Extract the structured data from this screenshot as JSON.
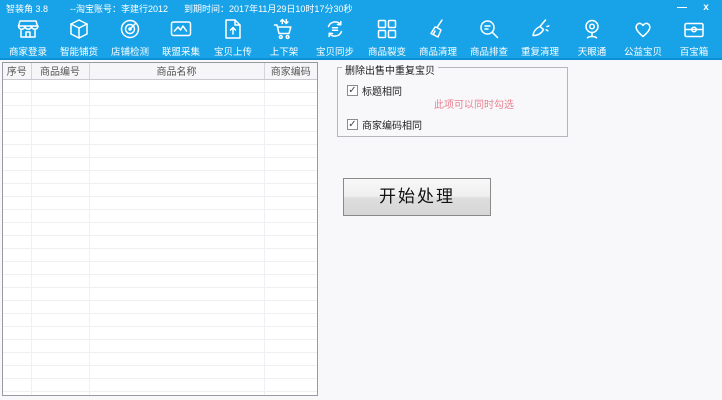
{
  "window": {
    "app_title": "智装角 3.8",
    "account": "--淘宝账号：李建行2012",
    "expire": "到期时间：2017年11月29日10时17分30秒",
    "minimize_glyph": "—",
    "close_glyph": "x"
  },
  "colors": {
    "titlebar_blue": "#18a3e8",
    "toolbar_divider": "#0d90d4",
    "hint_red": "#e8808f"
  },
  "toolbar": {
    "items": [
      {
        "label": "商家登录",
        "icon": "storefront-icon"
      },
      {
        "label": "智能铺货",
        "icon": "package-icon"
      },
      {
        "label": "店铺检测",
        "icon": "radar-icon"
      },
      {
        "label": "联盟采集",
        "icon": "capture-frame-icon"
      },
      {
        "label": "宝贝上传",
        "icon": "upload-document-icon"
      },
      {
        "label": "上下架",
        "icon": "cart-updown-icon"
      },
      {
        "label": "宝贝同步",
        "icon": "sync-icon"
      },
      {
        "label": "商品裂变",
        "icon": "grid-icon"
      },
      {
        "label": "商品清理",
        "icon": "broom-icon"
      },
      {
        "label": "商品排查",
        "icon": "search-list-icon"
      },
      {
        "label": "重复清理",
        "icon": "brush-icon"
      },
      {
        "label": "天眼通",
        "icon": "webcam-icon"
      },
      {
        "label": "公益宝贝",
        "icon": "heart-icon"
      },
      {
        "label": "百宝箱",
        "icon": "treasure-box-icon"
      }
    ]
  },
  "table": {
    "headers": [
      "序号",
      "商品编号",
      "商品名称",
      "商家编码"
    ],
    "rows": [],
    "empty_row_count": 25
  },
  "panel": {
    "group_title": "删除出售中重复宝贝",
    "options": [
      {
        "label": "标题相同",
        "checked": true
      },
      {
        "label": "商家编码相同",
        "checked": true
      }
    ],
    "hint": "此项可以同时勾选",
    "start_button": "开始处理"
  }
}
